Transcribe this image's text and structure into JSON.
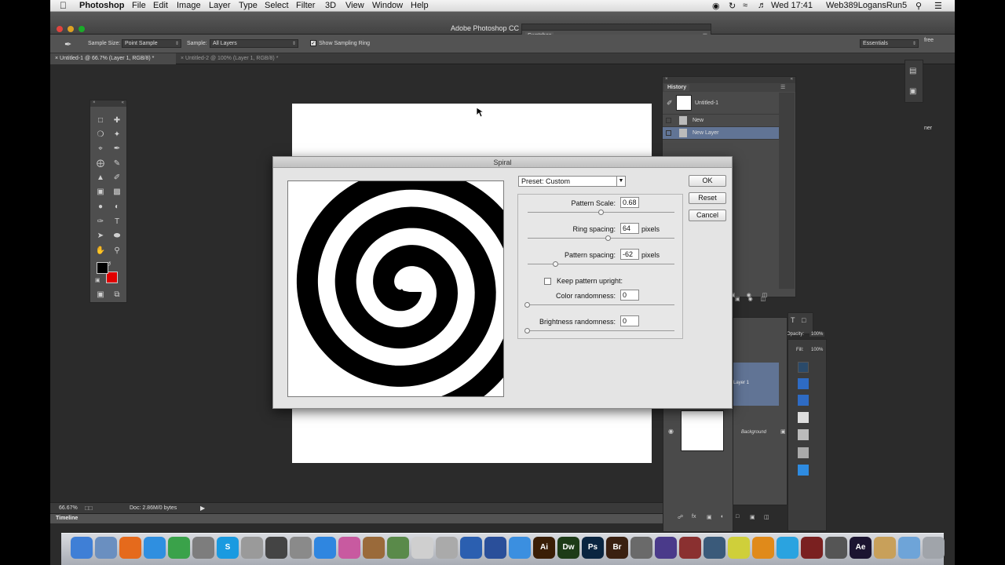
{
  "menubar": {
    "app": "Photoshop",
    "menus": [
      "File",
      "Edit",
      "Image",
      "Layer",
      "Type",
      "Select",
      "Filter",
      "3D",
      "View",
      "Window",
      "Help"
    ],
    "clock": "Wed 17:41",
    "user": "Web389LogansRun5"
  },
  "titlebar": {
    "title": "Adobe Photoshop CC",
    "swatches": "Swatches"
  },
  "options": {
    "sample_size_label": "Sample Size:",
    "sample_size_value": "Point Sample",
    "sample_label": "Sample:",
    "sample_value": "All Layers",
    "show_ring_label": "Show Sampling Ring",
    "workspace": "Essentials"
  },
  "tabs": [
    {
      "label": "Untitled-1 @ 66.7% (Layer 1, RGB/8) *"
    },
    {
      "label": "Untitled-2 @ 100% (Layer 1, RGB/8) *"
    }
  ],
  "history": {
    "title": "History",
    "snapshot": "Untitled-1",
    "items": [
      {
        "label": "New"
      },
      {
        "label": "New Layer"
      }
    ]
  },
  "layers": {
    "opacity_label": "Opacity:",
    "opacity_value": "100%",
    "fill_label": "Fill:",
    "fill_value": "100%",
    "layer1": "Layer 1",
    "background": "Background"
  },
  "right_edge": {
    "free": "free",
    "ner": "ner"
  },
  "status": {
    "zoom": "66.67%",
    "doc": "Doc: 2.86M/0 bytes",
    "timeline": "Timeline"
  },
  "dialog": {
    "title": "Spiral",
    "preset": "Preset: Custom",
    "pattern_scale_label": "Pattern Scale:",
    "pattern_scale_value": "0.68",
    "pattern_scale_level": 0.5,
    "ring_spacing_label": "Ring spacing:",
    "ring_spacing_value": "64",
    "ring_spacing_unit": "pixels",
    "ring_spacing_level": 0.55,
    "pattern_spacing_label": "Pattern spacing:",
    "pattern_spacing_value": "-62",
    "pattern_spacing_unit": "pixels",
    "pattern_spacing_level": 0.19,
    "keep_upright_label": "Keep pattern upright:",
    "keep_upright_checked": false,
    "color_rand_label": "Color randomness:",
    "color_rand_value": "0",
    "brightness_rand_label": "Brightness randomness:",
    "brightness_rand_value": "0",
    "ok": "OK",
    "reset": "Reset",
    "cancel": "Cancel"
  },
  "colors": {
    "foreground": "#000000",
    "background": "#e00000",
    "selection": "#617495"
  },
  "dock": [
    {
      "icon": "finder-icon",
      "label": "",
      "color": "#3f7fd6"
    },
    {
      "icon": "preview-icon",
      "label": "",
      "color": "#6a8fc0"
    },
    {
      "icon": "firefox-icon",
      "label": "",
      "color": "#e56a1c"
    },
    {
      "icon": "safari-icon",
      "label": "",
      "color": "#2f8fe0"
    },
    {
      "icon": "chrome-icon",
      "label": "",
      "color": "#3aa24a"
    },
    {
      "icon": "utility-icon",
      "label": "",
      "color": "#7d7d7d"
    },
    {
      "icon": "skype-icon",
      "label": "S",
      "color": "#1a9ae0"
    },
    {
      "icon": "scanner-icon",
      "label": "",
      "color": "#9a9a9a"
    },
    {
      "icon": "inkscape-icon",
      "label": "",
      "color": "#444444"
    },
    {
      "icon": "script-icon",
      "label": "",
      "color": "#8a8a8a"
    },
    {
      "icon": "appstore-icon",
      "label": "",
      "color": "#2f86e0"
    },
    {
      "icon": "picasa-icon",
      "label": "",
      "color": "#c85aa0"
    },
    {
      "icon": "garageband-icon",
      "label": "",
      "color": "#9a6a3a"
    },
    {
      "icon": "map-icon",
      "label": "",
      "color": "#5a8a4a"
    },
    {
      "icon": "textedit-icon",
      "label": "",
      "color": "#cfcfcf"
    },
    {
      "icon": "fontbook-icon",
      "label": "",
      "color": "#aaaaaa"
    },
    {
      "icon": "search-icon",
      "label": "",
      "color": "#2b5fb0"
    },
    {
      "icon": "network-icon",
      "label": "",
      "color": "#2a4f9a"
    },
    {
      "icon": "itunes-icon",
      "label": "",
      "color": "#3b8fe0"
    },
    {
      "icon": "illustrator-icon",
      "label": "Ai",
      "color": "#3a1e06"
    },
    {
      "icon": "dreamweaver-icon",
      "label": "Dw",
      "color": "#1d3b17"
    },
    {
      "icon": "photoshop-icon",
      "label": "Ps",
      "color": "#0a2540"
    },
    {
      "icon": "bridge-icon",
      "label": "Br",
      "color": "#3a2010"
    },
    {
      "icon": "acrobat-icon",
      "label": "",
      "color": "#6a6a6a"
    },
    {
      "icon": "imovie-icon",
      "label": "",
      "color": "#4a3a8a"
    },
    {
      "icon": "photo-booth-icon",
      "label": "",
      "color": "#8a3030"
    },
    {
      "icon": "trash-can-icon",
      "label": "",
      "color": "#3a5a7a"
    },
    {
      "icon": "photos-icon",
      "label": "",
      "color": "#cfcf3a"
    },
    {
      "icon": "ibooks-icon",
      "label": "",
      "color": "#e08a1a"
    },
    {
      "icon": "twitter-icon",
      "label": "",
      "color": "#2aa3e0"
    },
    {
      "icon": "dictionary-icon",
      "label": "",
      "color": "#7a2020"
    },
    {
      "icon": "camera-icon",
      "label": "",
      "color": "#555555"
    },
    {
      "icon": "after-effects-icon",
      "label": "Ae",
      "color": "#1b1430"
    },
    {
      "icon": "pattern-icon",
      "label": "",
      "color": "#c8a05a"
    },
    {
      "icon": "folder-icon",
      "label": "",
      "color": "#6ea4d8"
    },
    {
      "icon": "trash-icon",
      "label": "",
      "color": "#a0a4aa"
    }
  ]
}
